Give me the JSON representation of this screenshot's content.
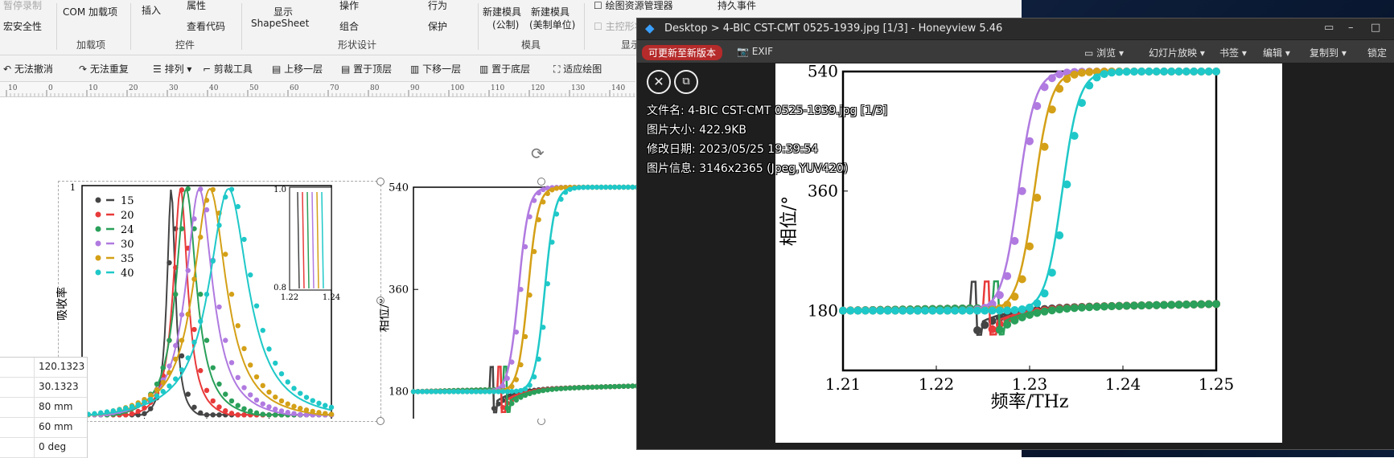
{
  "ribbon": {
    "row1": [
      "暂停录制",
      "COM 加载项",
      "插入",
      "属性",
      "显示",
      "操作",
      "行为",
      "新建模具",
      "新建模具",
      "绘图资源管理器",
      "持久事件"
    ],
    "macro_security": "宏安全性",
    "insert_sub": "ShapeSheet",
    "view_code": "查看代码",
    "group_label": "组合",
    "protect": "保护",
    "metric": "(公制)",
    "us_units": "(美制单位)",
    "master_shape": "主控形状",
    "groups": [
      "加载项",
      "控件",
      "形状设计",
      "模具",
      "显示"
    ]
  },
  "toolbar2": [
    "无法撤消",
    "无法重复",
    "排列",
    "剪裁工具",
    "上移一层",
    "置于顶层",
    "下移一层",
    "置于底层",
    "适应绘图"
  ],
  "ruler_ticks": [
    "10",
    "0",
    "10",
    "20",
    "30",
    "40",
    "50",
    "60",
    "70",
    "80",
    "90",
    "100",
    "110",
    "120",
    "130",
    "140",
    "150"
  ],
  "props": [
    "120.1323",
    "30.1323",
    "80 mm",
    "60 mm",
    "0 deg"
  ],
  "viewer": {
    "title": "Desktop > 4-BIC CST-CMT 0525-1939.jpg [1/3] - Honeyview 5.46",
    "update_button": "可更新至新版本",
    "exif": "EXIF",
    "menu": [
      "浏览",
      "幻灯片放映",
      "书签",
      "编辑",
      "复制到",
      "锁定"
    ],
    "info": [
      "文件名: 4-BIC CST-CMT 0525-1939.jpg [1/3]",
      "图片大小: 422.9KB",
      "修改日期: 2023/05/25 19:39:54",
      "图片信息: 3146x2365 (Jpeg,YUV420)"
    ]
  },
  "colors": {
    "s15": "#444444",
    "s20": "#e83a3a",
    "s24": "#2aa05a",
    "s30": "#b07ae0",
    "s35": "#d4a017",
    "s40": "#1fc8c8"
  },
  "chart_data": [
    {
      "type": "line",
      "xlabel": "频率/THz",
      "ylabel": "吸收率",
      "xlim": [
        1.21,
        1.25
      ],
      "ylim": [
        0,
        1
      ],
      "xticks": [
        "1.21",
        "1.22",
        "1.23",
        "1.24",
        "1.25"
      ],
      "yticks": [
        "1"
      ],
      "series": [
        {
          "name": "15",
          "peak": 1.2243
        },
        {
          "name": "20",
          "peak": 1.2258
        },
        {
          "name": "24",
          "peak": 1.2267
        },
        {
          "name": "30",
          "peak": 1.2288
        },
        {
          "name": "35",
          "peak": 1.2305
        },
        {
          "name": "40",
          "peak": 1.2335
        }
      ],
      "inset": {
        "xlim": [
          1.22,
          1.24
        ],
        "ylim": [
          0.8,
          1.0
        ],
        "xticks": [
          "1.22",
          "1.24"
        ],
        "yticks": [
          "1.0",
          "0.8"
        ]
      }
    },
    {
      "type": "line",
      "xlabel": "频率/THz",
      "ylabel": "相位/°",
      "xlim": [
        1.21,
        1.25
      ],
      "ylim": [
        90,
        540
      ],
      "xticks": [
        "1.21",
        "1.22",
        "1.23",
        "1.24",
        "1.25"
      ],
      "yticks": [
        "180",
        "360",
        "540"
      ],
      "series": [
        {
          "name": "15",
          "center": 1.2243
        },
        {
          "name": "20",
          "center": 1.2258
        },
        {
          "name": "24",
          "center": 1.2267
        },
        {
          "name": "30",
          "center": 1.2288
        },
        {
          "name": "35",
          "center": 1.2305
        },
        {
          "name": "40",
          "center": 1.2335
        }
      ]
    }
  ]
}
